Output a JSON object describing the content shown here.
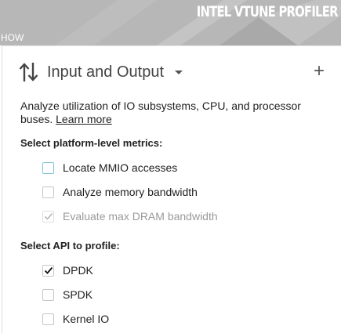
{
  "app": {
    "brand": "INTEL VTUNE PROFILER",
    "how_label": "HOW"
  },
  "analysis": {
    "title": "Input and Output",
    "description": "Analyze utilization of IO subsystems, CPU, and processor buses.",
    "learn_more": "Learn more"
  },
  "platform_metrics": {
    "label": "Select platform-level metrics:",
    "options": [
      {
        "label": "Locate MMIO accesses",
        "checked": false,
        "enabled": true
      },
      {
        "label": "Analyze memory bandwidth",
        "checked": false,
        "enabled": true
      },
      {
        "label": "Evaluate max DRAM bandwidth",
        "checked": true,
        "enabled": false
      }
    ]
  },
  "api": {
    "label": "Select API to profile:",
    "options": [
      {
        "label": "DPDK",
        "checked": true,
        "enabled": true
      },
      {
        "label": "SPDK",
        "checked": false,
        "enabled": true
      },
      {
        "label": "Kernel IO",
        "checked": false,
        "enabled": true
      }
    ]
  },
  "icons": {
    "title_icon": "sort-arrows-icon",
    "dropdown_icon": "caret-down-icon",
    "add_icon": "plus-icon",
    "check_icon": "checkmark-icon"
  },
  "colors": {
    "header_bg": "#b7b7b7",
    "brand_text": "#ffffff",
    "checkbox_focus": "#7ec3d6",
    "disabled_text": "#9a9a9a"
  }
}
